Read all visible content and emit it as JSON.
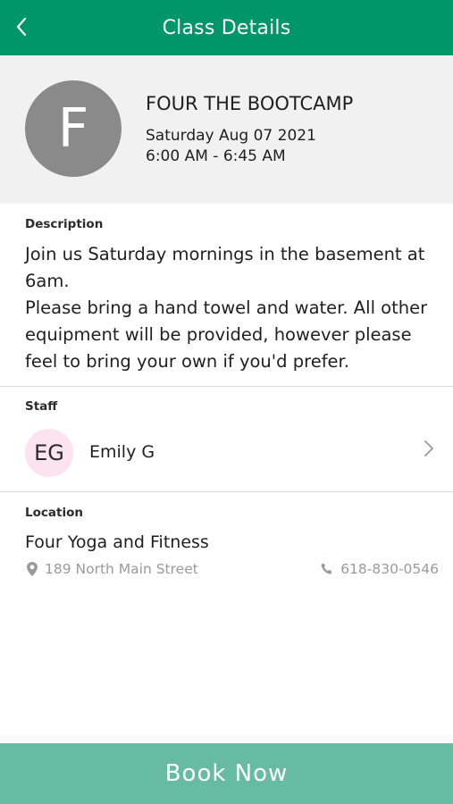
{
  "header": {
    "title": "Class Details",
    "back_icon": "chevron-left-icon"
  },
  "class": {
    "avatar_letter": "F",
    "name": "FOUR THE BOOTCAMP",
    "date": "Saturday Aug 07 2021",
    "time": "6:00 AM - 6:45 AM"
  },
  "description": {
    "label": "Description",
    "line1": "Join us Saturday mornings in the basement at 6am.",
    "line2": "Please bring a hand towel and water. All other equipment will be provided, however please feel to bring your own if you'd prefer."
  },
  "staff": {
    "label": "Staff",
    "initials": "EG",
    "name": "Emily G"
  },
  "location": {
    "label": "Location",
    "name": "Four Yoga and Fitness",
    "address": "189 North Main Street",
    "phone": "618-830-0546"
  },
  "footer": {
    "book_label": "Book Now"
  },
  "colors": {
    "header": "#00966a",
    "book_button": "#66bba2",
    "avatar_bg": "#8a8a8a",
    "staff_avatar_bg": "#fde3ee"
  }
}
